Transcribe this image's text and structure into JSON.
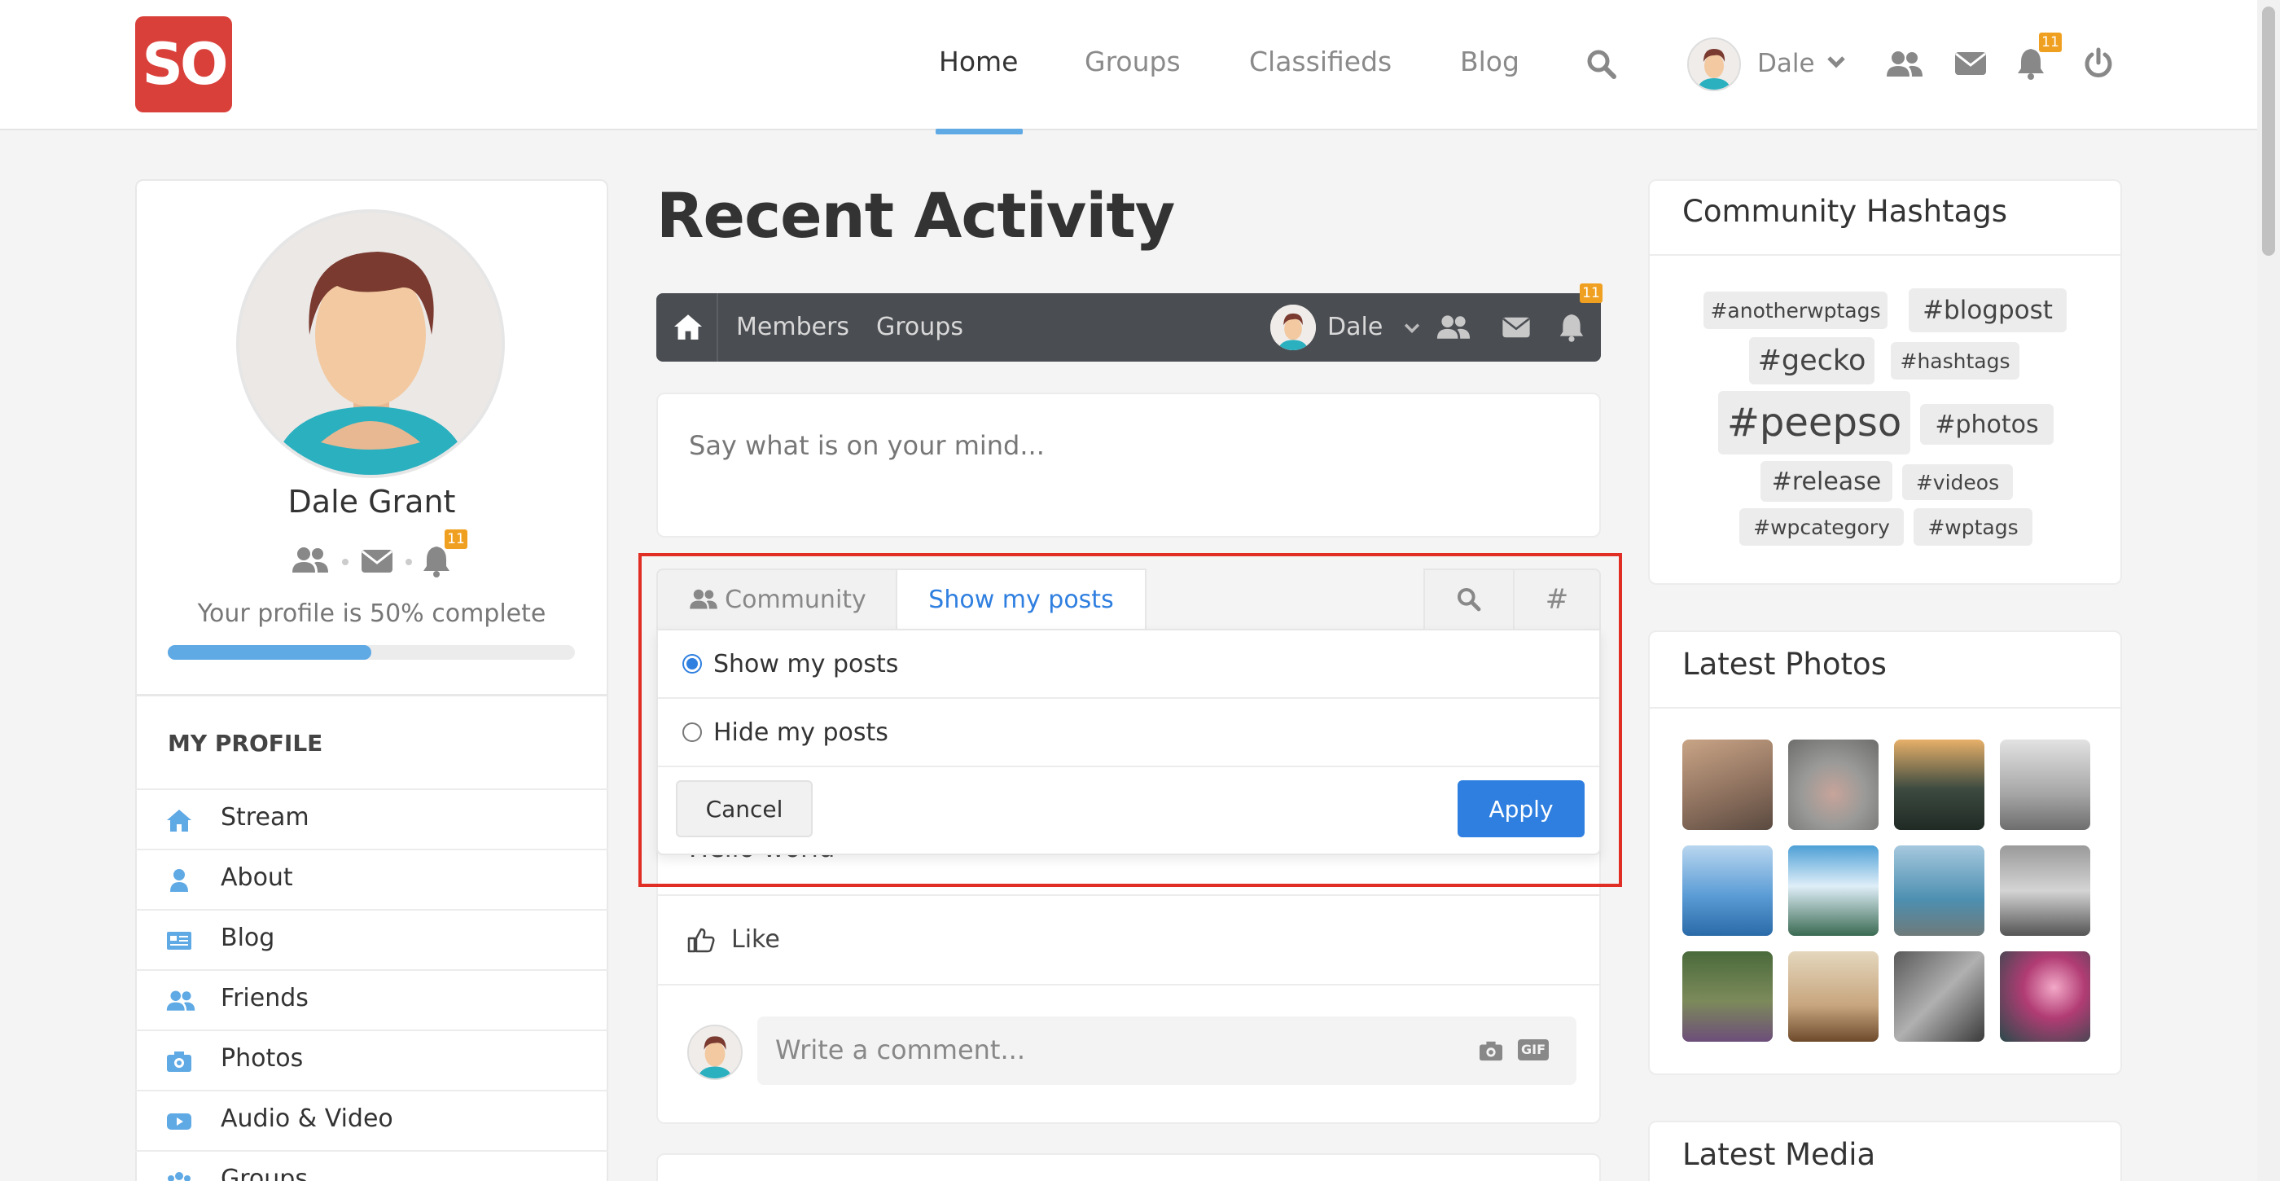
{
  "header": {
    "logo_text": "SO",
    "nav": [
      "Home",
      "Groups",
      "Classifieds",
      "Blog"
    ],
    "active_nav": "Home",
    "user_name": "Dale",
    "notification_count": "11"
  },
  "profile": {
    "name": "Dale Grant",
    "notification_count": "11",
    "completion_text": "Your profile is 50% complete",
    "completion_fraction": 0.5,
    "menu_title": "MY PROFILE",
    "menu": [
      "Stream",
      "About",
      "Blog",
      "Friends",
      "Photos",
      "Audio & Video",
      "Groups"
    ]
  },
  "main": {
    "title": "Recent Activity",
    "subnav": {
      "links": [
        "Members",
        "Groups"
      ],
      "user_name": "Dale",
      "notification_count": "11"
    },
    "composer_placeholder": "Say what is on your mind...",
    "filter": {
      "tab_community": "Community",
      "tab_posts": "Show my posts",
      "hash_symbol": "#",
      "options": [
        "Show my posts",
        "Hide my posts"
      ],
      "selected": "Show my posts",
      "cancel": "Cancel",
      "apply": "Apply"
    },
    "post": {
      "partial_text": "Hello world",
      "like_label": "Like",
      "comment_placeholder": "Write a comment...",
      "gif_label": "GIF"
    }
  },
  "sidebar": {
    "hashtags_title": "Community Hashtags",
    "hashtags": [
      "#anotherwptags",
      "#blogpost",
      "#gecko",
      "#hashtags",
      "#peepso",
      "#photos",
      "#release",
      "#videos",
      "#wpcategory",
      "#wptags"
    ],
    "photos_title": "Latest Photos",
    "media_title": "Latest Media"
  },
  "colors": {
    "brand": "#d9403a",
    "accent": "#2f7fe0",
    "link_blue": "#5fa9e4",
    "badge": "#f0a020",
    "highlight": "#e02e25"
  }
}
